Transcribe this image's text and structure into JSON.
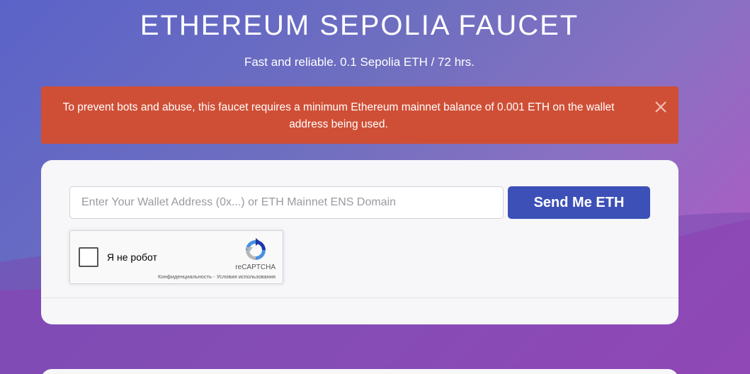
{
  "header": {
    "title": "ETHEREUM SEPOLIA FAUCET",
    "subtitle": "Fast and reliable. 0.1 Sepolia ETH / 72 hrs."
  },
  "alert": {
    "text": "To prevent bots and abuse, this faucet requires a minimum Ethereum mainnet balance of 0.001 ETH on the wallet address being used.",
    "close_icon": "close-icon",
    "color": "#cf4f36"
  },
  "form": {
    "wallet_input": {
      "value": "",
      "placeholder": "Enter Your Wallet Address (0x...) or ETH Mainnet ENS Domain"
    },
    "send_button_label": "Send Me ETH",
    "send_button_color": "#3d50b8"
  },
  "recaptcha": {
    "checkbox_label": "Я не робот",
    "brand": "reCAPTCHA",
    "privacy_link": "Конфиденциальность",
    "separator": "-",
    "terms_link": "Условия использования",
    "logo_icon": "recaptcha-logo-icon"
  }
}
